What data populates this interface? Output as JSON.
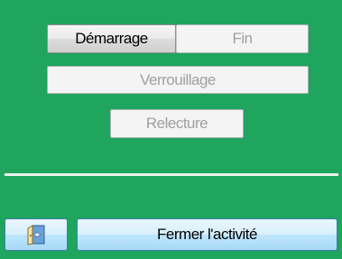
{
  "panel": {
    "background_color": "#1fa55e"
  },
  "buttons": {
    "demarrage": "Démarrage",
    "fin": "Fin",
    "verrouillage": "Verrouillage",
    "relecture": "Relecture",
    "fermer_activite": "Fermer l'activité"
  },
  "states": {
    "demarrage_enabled": true,
    "fin_enabled": false,
    "verrouillage_enabled": false,
    "relecture_enabled": false,
    "fermer_activite_enabled": true
  },
  "icons": {
    "exit_button_icon": "exit-door-icon"
  }
}
